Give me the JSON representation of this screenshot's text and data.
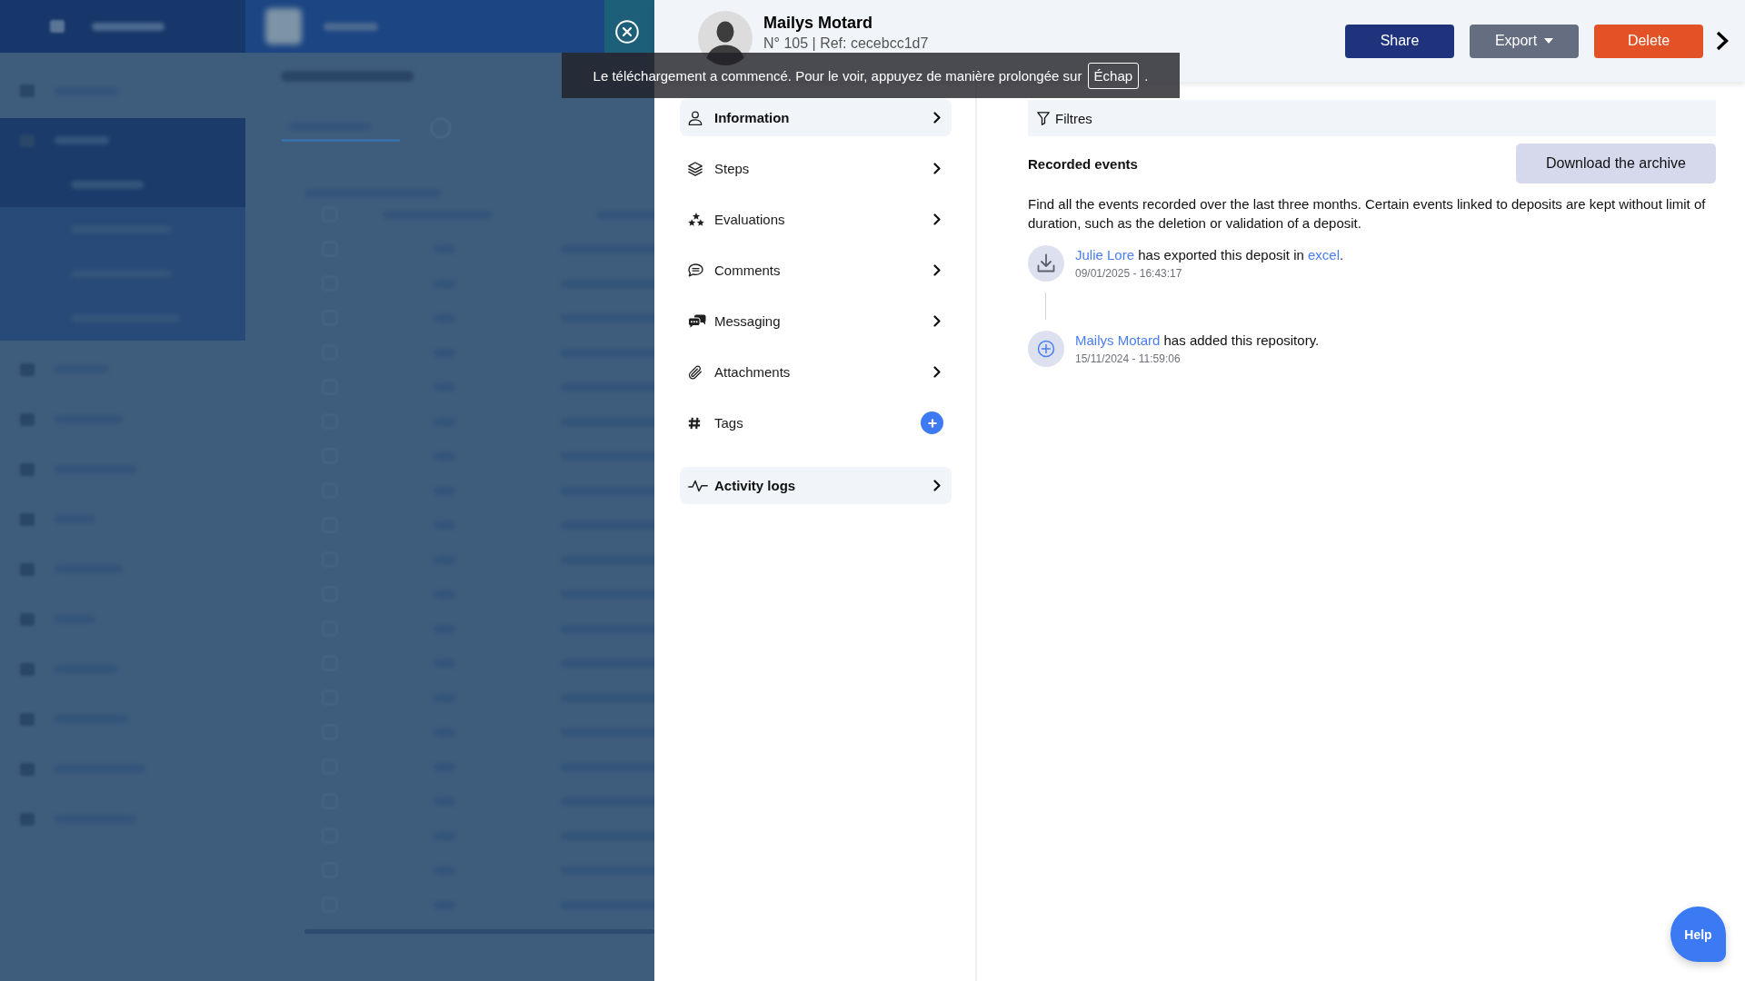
{
  "toast": {
    "message": "Le téléchargement a commencé. Pour le voir, appuyez de manière prolongée sur",
    "key": "Échap",
    "end": "."
  },
  "header": {
    "name": "Mailys Motard",
    "reference": "N° 105 | Ref: cecebcc1d7",
    "actions": [
      {
        "label": "Share",
        "kind": "primary"
      },
      {
        "label": "Export",
        "kind": "dropdown"
      },
      {
        "label": "Delete",
        "kind": "danger"
      }
    ]
  },
  "menu": {
    "sections": [
      {
        "items": [
          {
            "label": "Information",
            "kind": "link",
            "selected": true
          },
          {
            "label": "Steps",
            "kind": "link",
            "selected": false
          },
          {
            "label": "Evaluations",
            "kind": "link",
            "selected": false
          },
          {
            "label": "Comments",
            "kind": "link",
            "selected": false
          },
          {
            "label": "Messaging",
            "kind": "link",
            "selected": false
          },
          {
            "label": "Attachments",
            "kind": "link",
            "selected": false
          },
          {
            "label": "Tags",
            "kind": "add",
            "selected": false
          }
        ]
      },
      {
        "items": [
          {
            "label": "Activity logs",
            "kind": "link",
            "selected": true
          }
        ]
      }
    ]
  },
  "activity": {
    "filters": {
      "label": "Filtres"
    },
    "title": "Recorded events",
    "download_button": "Download the archive",
    "description": "Find all the events recorded over the last three months. Certain events linked to deposits are kept without limit of duration, such as the deletion or validation of a deposit.",
    "events": [
      {
        "kind": "export",
        "actor": "Julie Lore",
        "action": "has exported this deposit in",
        "target": "excel",
        "end": ".",
        "timestamp": "09/01/2025 - 16:43:17"
      },
      {
        "kind": "add",
        "actor": "Mailys Motard",
        "action": "has added this repository",
        "end": ".",
        "timestamp": "15/11/2024 - 11:59:06"
      }
    ]
  },
  "help_button": {
    "label": "Help"
  }
}
